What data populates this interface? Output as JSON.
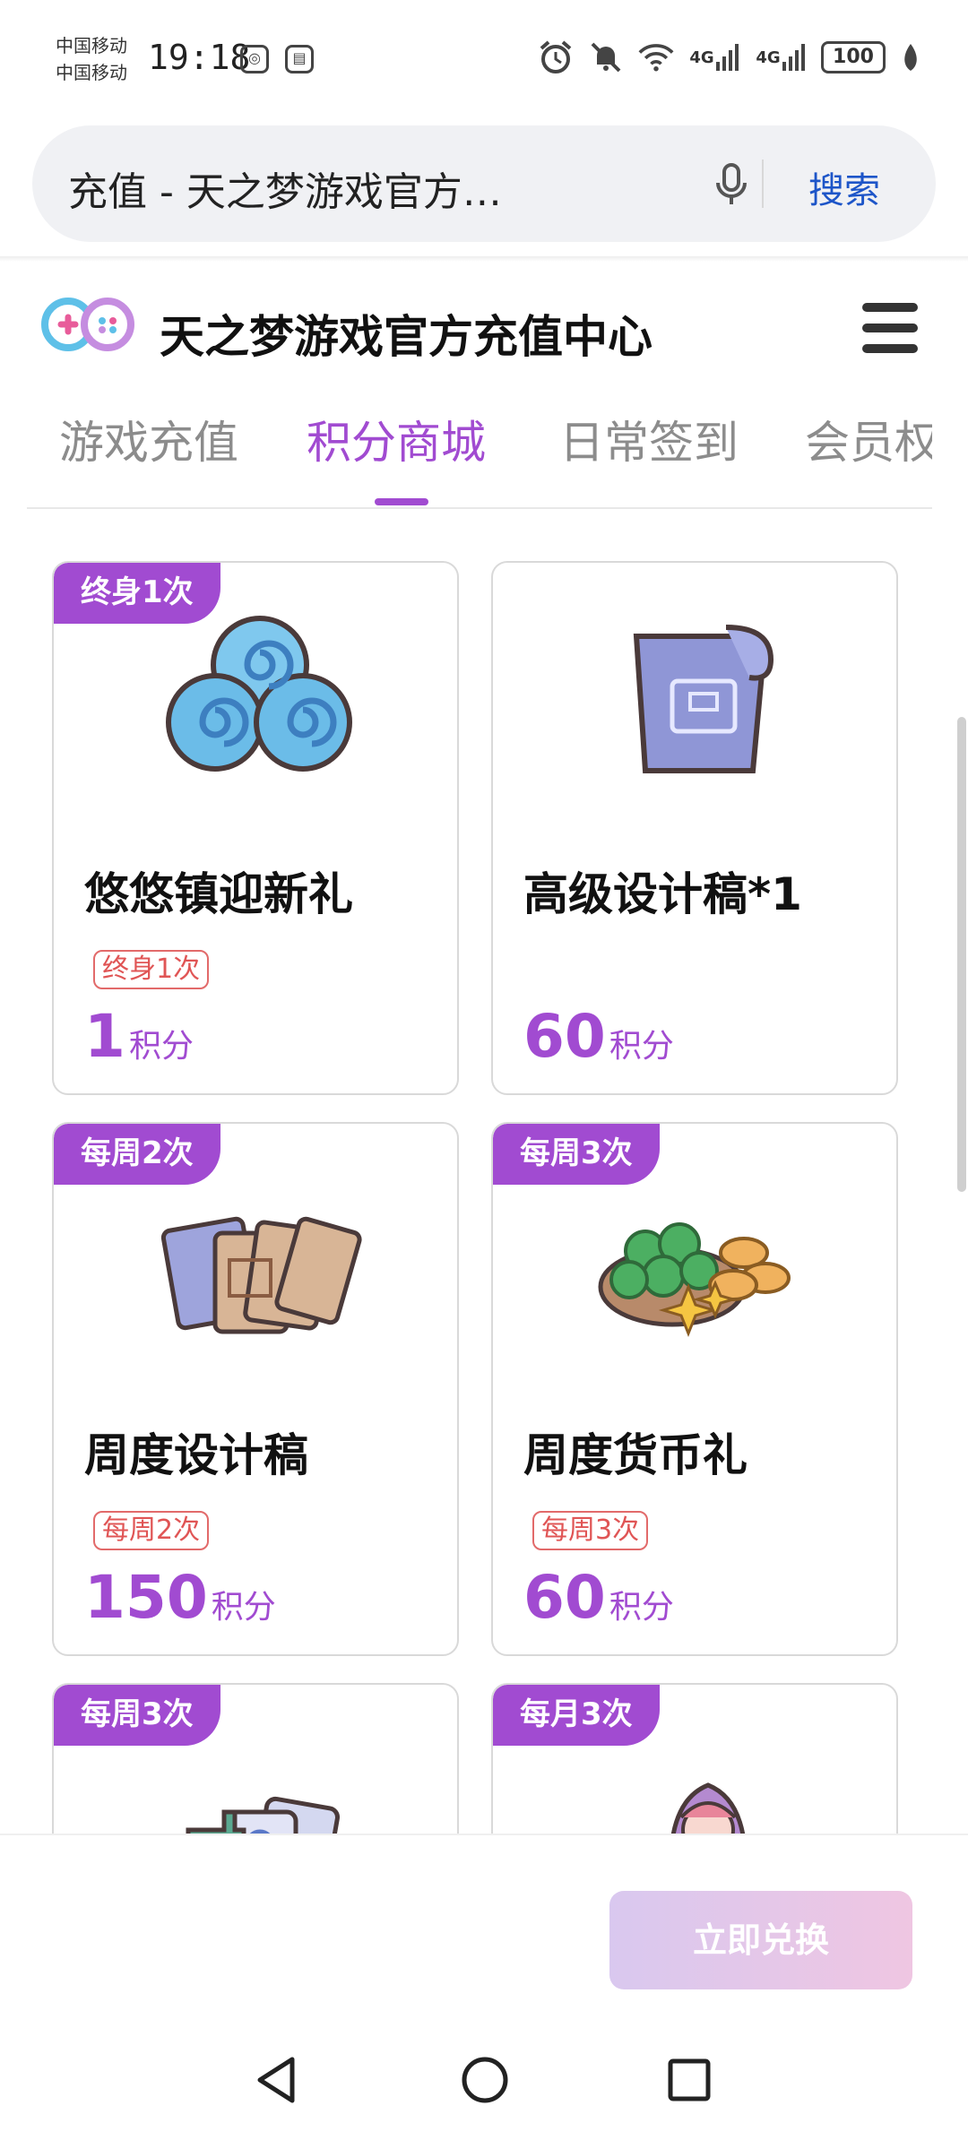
{
  "status_bar": {
    "carrier_1": "中国移动",
    "carrier_2": "中国移动",
    "time": "19:18",
    "network_1": "4G",
    "network_2": "4G",
    "battery": "100"
  },
  "search_bar": {
    "query": "充值 - 天之梦游戏官方…",
    "search_label": "搜索"
  },
  "site": {
    "title": "天之梦游戏官方充值中心"
  },
  "tabs": [
    {
      "label": "游戏充值",
      "active": false
    },
    {
      "label": "积分商城",
      "active": true
    },
    {
      "label": "日常签到",
      "active": false
    },
    {
      "label": "会员权",
      "active": false
    }
  ],
  "items": [
    {
      "badge": "终身1次",
      "name": "悠悠镇迎新礼",
      "limit": "终身1次",
      "price": "1",
      "unit": "积分"
    },
    {
      "badge": "",
      "name": "高级设计稿*1",
      "limit": "",
      "price": "60",
      "unit": "积分"
    },
    {
      "badge": "每周2次",
      "name": "周度设计稿",
      "limit": "每周2次",
      "price": "150",
      "unit": "积分"
    },
    {
      "badge": "每周3次",
      "name": "周度货币礼",
      "limit": "每周3次",
      "price": "60",
      "unit": "积分"
    },
    {
      "badge": "每周3次",
      "name": "",
      "limit": "",
      "price": "",
      "unit": ""
    },
    {
      "badge": "每月3次",
      "name": "",
      "limit": "",
      "price": "",
      "unit": ""
    }
  ],
  "actions": {
    "redeem_label": "立即兑换"
  },
  "colors": {
    "accent": "#a14bd1",
    "limit_tag": "#e05555",
    "search_link": "#1d55c8"
  }
}
